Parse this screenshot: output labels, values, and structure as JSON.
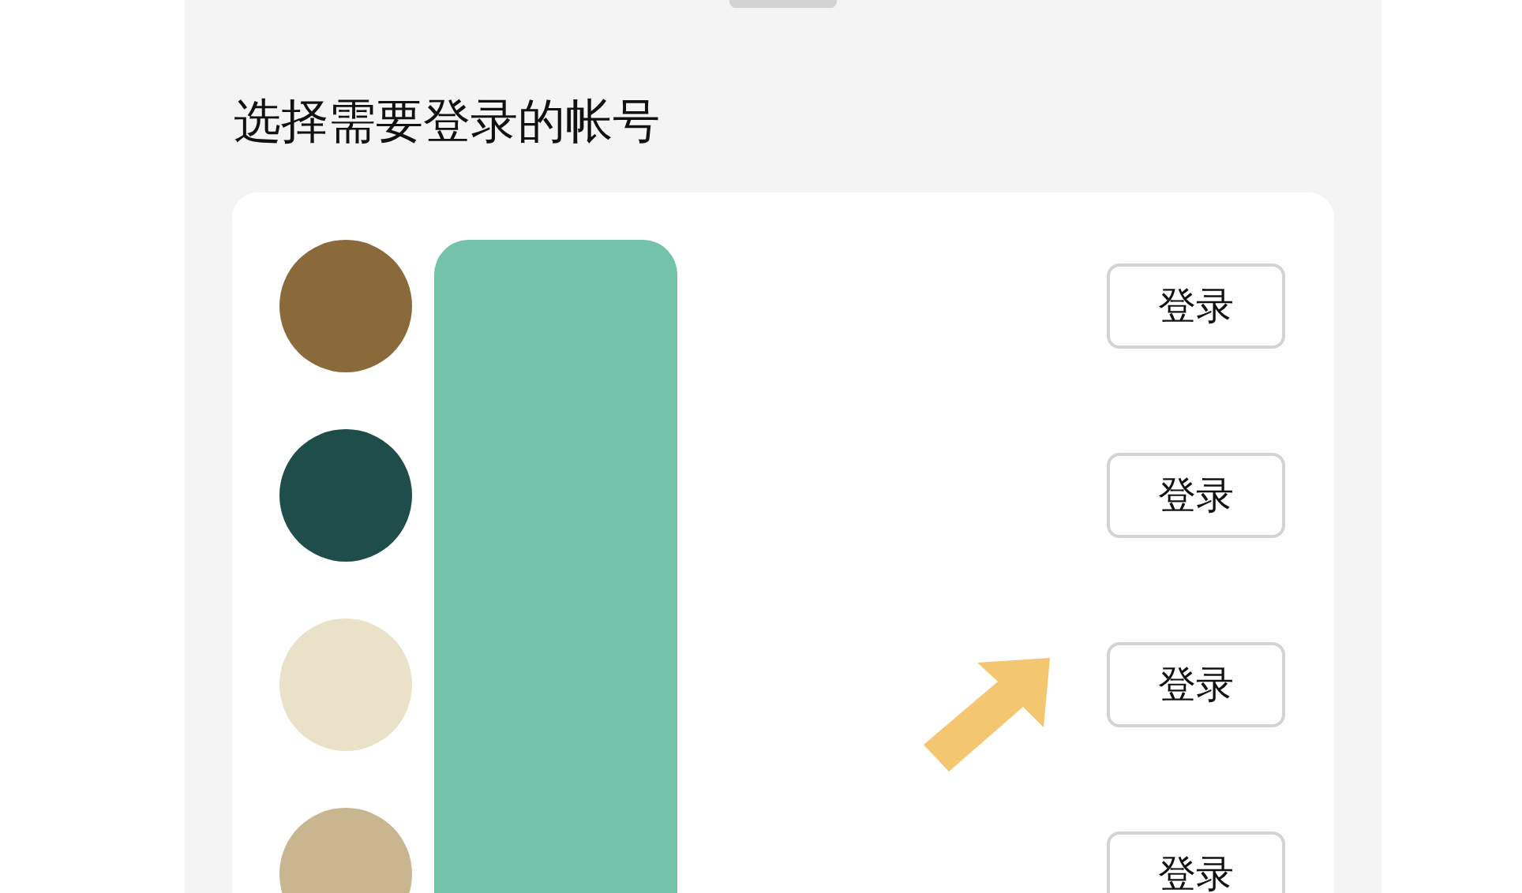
{
  "title": "选择需要登录的帐号",
  "accounts": [
    {
      "button": "登录",
      "pointed": false
    },
    {
      "button": "登录",
      "pointed": false
    },
    {
      "button": "登录",
      "pointed": true
    },
    {
      "button": "登录",
      "pointed": false
    }
  ]
}
